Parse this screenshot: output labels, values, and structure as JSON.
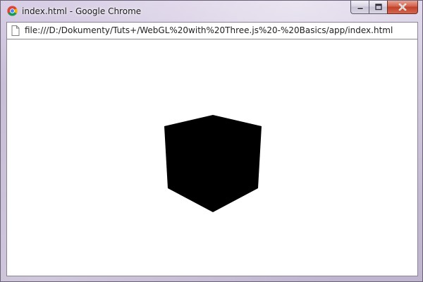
{
  "window": {
    "title": "index.html - Google Chrome",
    "browser_icon": "chrome-logo-icon",
    "caption_buttons": [
      "minimize-icon",
      "maximize-icon",
      "close-icon"
    ]
  },
  "address_bar": {
    "page_icon": "page-icon",
    "url": "file:///D:/Dokumenty/Tuts+/WebGL%20with%20Three.js%20-%20Basics/app/index.html"
  },
  "viewport": {
    "background_color": "#ffffff",
    "object": "cube",
    "object_color": "#000000"
  }
}
